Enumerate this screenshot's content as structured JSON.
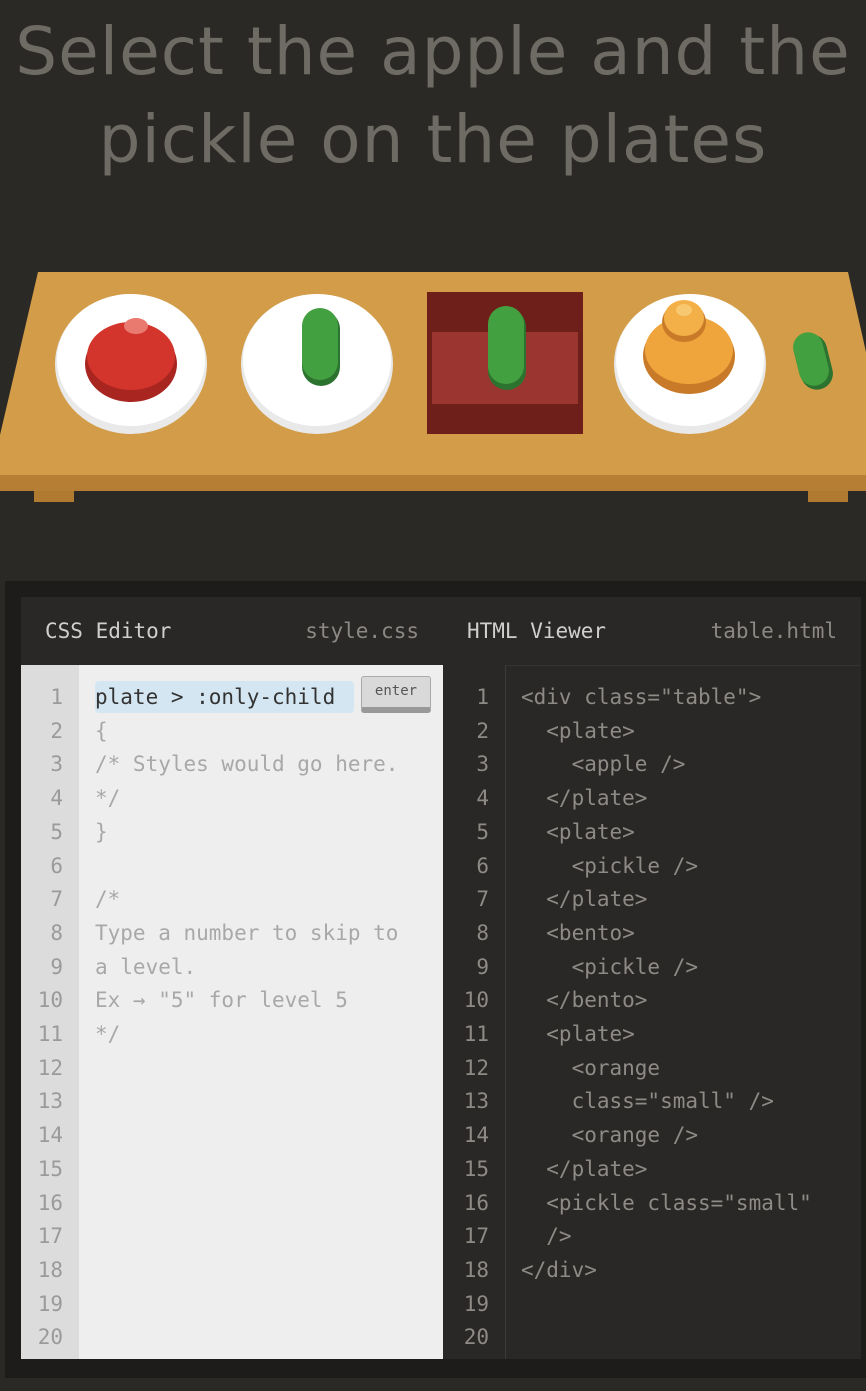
{
  "instruction": "Select the apple and the pickle on the plates",
  "css_editor": {
    "title": "CSS Editor",
    "file": "style.css",
    "input_value": "plate > :only-child",
    "enter_label": "enter",
    "lines": [
      "{",
      "/* Styles would go here.",
      "*/",
      "}",
      "",
      "/*",
      "Type a number to skip to",
      "a level.",
      "Ex → \"5\" for level 5",
      "*/"
    ],
    "line_numbers": [
      "1",
      "2",
      "3",
      "4",
      "5",
      "6",
      "7",
      "8",
      "9",
      "10",
      "11",
      "12",
      "13",
      "14",
      "15",
      "16",
      "17",
      "18",
      "19",
      "20"
    ]
  },
  "html_viewer": {
    "title": "HTML Viewer",
    "file": "table.html",
    "lines": [
      "<div class=\"table\">",
      "  <plate>",
      "    <apple />",
      "  </plate>",
      "  <plate>",
      "    <pickle />",
      "  </plate>",
      "  <bento>",
      "    <pickle />",
      "  </bento>",
      "  <plate>",
      "    <orange",
      "    class=\"small\" />",
      "    <orange />",
      "  </plate>",
      "  <pickle class=\"small\"",
      "  />",
      "</div>"
    ],
    "line_numbers": [
      "1",
      "2",
      "3",
      "4",
      "5",
      "6",
      "7",
      "8",
      "9",
      "10",
      "11",
      "12",
      "13",
      "14",
      "15",
      "16",
      "17",
      "18",
      "19",
      "20"
    ]
  },
  "table_items": [
    "plate-apple",
    "plate-pickle",
    "bento-pickle",
    "plate-oranges",
    "small-pickle"
  ],
  "colors": {
    "background": "#2b2926",
    "table": "#d09a46",
    "plate": "#ffffff",
    "apple": "#cc3028",
    "pickle": "#3e9a3c",
    "orange": "#eba43c",
    "bento": "#8c2a22"
  }
}
